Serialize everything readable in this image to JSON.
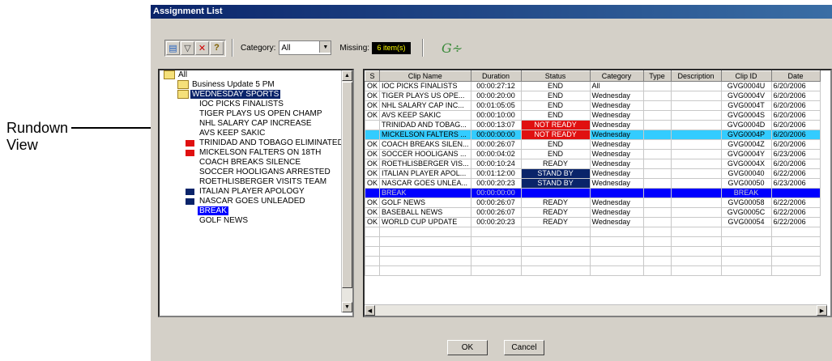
{
  "callout": {
    "line1": "Rundown",
    "line2": "View"
  },
  "window": {
    "title": "Assignment List"
  },
  "toolbar": {
    "category_label": "Category:",
    "category_value": "All",
    "missing_label": "Missing:",
    "missing_value": "6 item(s)"
  },
  "tree": {
    "items": [
      {
        "label": "All",
        "level": 0,
        "folder": true
      },
      {
        "label": "Business Update 5 PM",
        "level": 1,
        "folder": true
      },
      {
        "label": "WEDNESDAY SPORTS",
        "level": 1,
        "folder": true,
        "state": "selected-dark"
      },
      {
        "label": "IOC PICKS FINALISTS",
        "level": 2
      },
      {
        "label": "TIGER PLAYS US OPEN CHAMP",
        "level": 2
      },
      {
        "label": "NHL SALARY CAP INCREASE",
        "level": 2
      },
      {
        "label": "AVS KEEP SAKIC",
        "level": 2
      },
      {
        "label": "TRINIDAD AND TOBAGO ELIMINATED",
        "level": 2,
        "marker": "#e01010"
      },
      {
        "label": "MICKELSON FALTERS ON 18TH",
        "level": 2,
        "marker": "#e01010"
      },
      {
        "label": "COACH BREAKS SILENCE",
        "level": 2
      },
      {
        "label": "SOCCER HOOLIGANS ARRESTED",
        "level": 2
      },
      {
        "label": "ROETHLISBERGER VISITS TEAM",
        "level": 2
      },
      {
        "label": "ITALIAN PLAYER APOLOGY",
        "level": 2,
        "marker": "#0a246a"
      },
      {
        "label": "NASCAR GOES UNLEADED",
        "level": 2,
        "marker": "#0a246a"
      },
      {
        "label": "BREAK",
        "level": 2,
        "state": "selected-blue"
      },
      {
        "label": "GOLF NEWS",
        "level": 2
      }
    ]
  },
  "grid": {
    "columns": [
      "S",
      "Clip Name",
      "Duration",
      "Status",
      "Category",
      "Type",
      "Description",
      "Clip ID",
      "Date"
    ],
    "rows": [
      {
        "s": "OK",
        "name": "IOC PICKS FINALISTS",
        "dur": "00:00:27:12",
        "status": "END",
        "cat": "All",
        "type": "",
        "desc": "",
        "id": "GVG0004U",
        "date": "6/20/2006"
      },
      {
        "s": "OK",
        "name": "TIGER PLAYS US OPE...",
        "dur": "00:00:20:00",
        "status": "END",
        "cat": "Wednesday",
        "type": "",
        "desc": "",
        "id": "GVG0004V",
        "date": "6/20/2006"
      },
      {
        "s": "OK",
        "name": "NHL SALARY CAP INC...",
        "dur": "00:01:05:05",
        "status": "END",
        "cat": "Wednesday",
        "type": "",
        "desc": "",
        "id": "GVG0004T",
        "date": "6/20/2006"
      },
      {
        "s": "OK",
        "name": "AVS KEEP SAKIC",
        "dur": "00:00:10:00",
        "status": "END",
        "cat": "Wednesday",
        "type": "",
        "desc": "",
        "id": "GVG0004S",
        "date": "6/20/2006"
      },
      {
        "s": "",
        "name": "TRINIDAD AND TOBAG...",
        "dur": "00:00:13:07",
        "status": "NOT READY",
        "cat": "Wednesday",
        "type": "",
        "desc": "",
        "id": "GVG0004D",
        "date": "6/20/2006",
        "status_style": "red"
      },
      {
        "s": "",
        "name": "MICKELSON FALTERS ...",
        "dur": "00:00:00:00",
        "status": "NOT READY",
        "cat": "Wednesday",
        "type": "",
        "desc": "",
        "id": "GVG0004P",
        "date": "6/20/2006",
        "status_style": "red",
        "row_style": "cyan"
      },
      {
        "s": "OK",
        "name": "COACH BREAKS SILEN...",
        "dur": "00:00:26:07",
        "status": "END",
        "cat": "Wednesday",
        "type": "",
        "desc": "",
        "id": "GVG0004Z",
        "date": "6/20/2006"
      },
      {
        "s": "OK",
        "name": "SOCCER HOOLIGANS ...",
        "dur": "00:00:04:02",
        "status": "END",
        "cat": "Wednesday",
        "type": "",
        "desc": "",
        "id": "GVG0004Y",
        "date": "6/23/2006"
      },
      {
        "s": "OK",
        "name": "ROETHLISBERGER VIS...",
        "dur": "00:00:10:24",
        "status": "READY",
        "cat": "Wednesday",
        "type": "",
        "desc": "",
        "id": "GVG0004X",
        "date": "6/20/2006"
      },
      {
        "s": "OK",
        "name": "ITALIAN PLAYER APOL...",
        "dur": "00:01:12:00",
        "status": "STAND BY",
        "cat": "Wednesday",
        "type": "",
        "desc": "",
        "id": "GVG00040",
        "date": "6/22/2006",
        "status_style": "navy"
      },
      {
        "s": "OK",
        "name": "NASCAR GOES UNLEA...",
        "dur": "00:00:20:23",
        "status": "STAND BY",
        "cat": "Wednesday",
        "type": "",
        "desc": "",
        "id": "GVG00050",
        "date": "6/23/2006",
        "status_style": "navy"
      },
      {
        "s": "",
        "name": "BREAK",
        "dur": "00:00:00:00",
        "status": "",
        "cat": "",
        "type": "",
        "desc": "",
        "id": "BREAK",
        "date": "",
        "row_style": "bluerow"
      },
      {
        "s": "OK",
        "name": "GOLF NEWS",
        "dur": "00:00:26:07",
        "status": "READY",
        "cat": "Wednesday",
        "type": "",
        "desc": "",
        "id": "GVG00058",
        "date": "6/22/2006"
      },
      {
        "s": "OK",
        "name": "BASEBALL NEWS",
        "dur": "00:00:26:07",
        "status": "READY",
        "cat": "Wednesday",
        "type": "",
        "desc": "",
        "id": "GVG0005C",
        "date": "6/22/2006"
      },
      {
        "s": "OK",
        "name": "WORLD CUP UPDATE",
        "dur": "00:00:20:23",
        "status": "READY",
        "cat": "Wednesday",
        "type": "",
        "desc": "",
        "id": "GVG00054",
        "date": "6/22/2006"
      }
    ]
  },
  "buttons": {
    "ok": "OK",
    "cancel": "Cancel"
  }
}
